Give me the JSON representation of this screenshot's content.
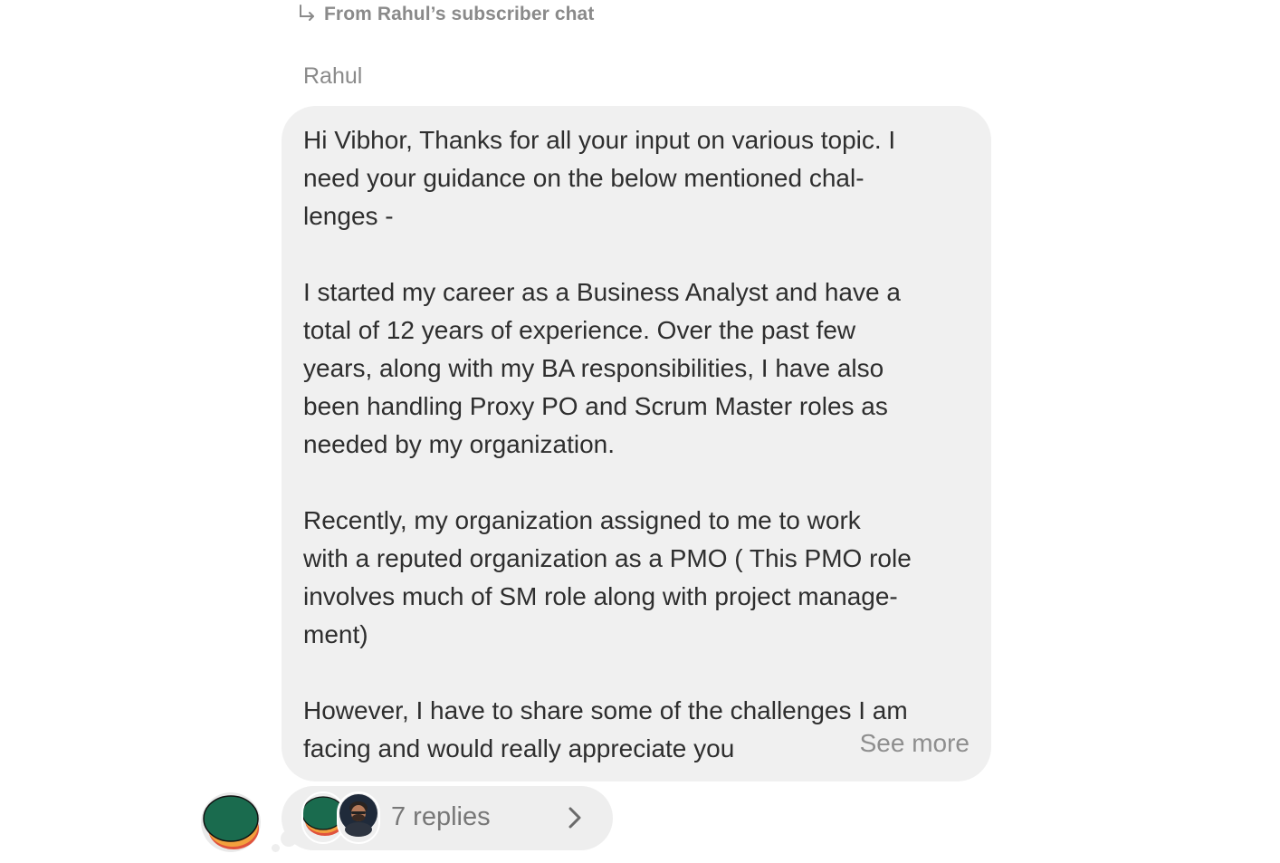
{
  "header": {
    "forwarded_from": "From Rahul’s subscriber chat"
  },
  "message": {
    "sender": "Rahul",
    "paragraphs": [
      [
        "Hi Vibhor, Thanks for all your input on various topic. I",
        "need your guidance on the below mentioned chal-",
        "lenges -"
      ],
      [
        "I started my career as a Business Analyst and have a",
        "total of 12 years of experience. Over the past few",
        "years, along with my BA responsibilities, I have also",
        "been handling Proxy PO and Scrum Master roles as",
        "needed by my organization."
      ],
      [
        "Recently, my organization assigned to me to work",
        "with a reputed organization as a PMO ( This PMO role",
        "involves much of SM role along with project manage-",
        "ment)"
      ],
      [
        "However, I have to share some of the challenges I am",
        "facing and would really appreciate you"
      ]
    ],
    "see_more": "See more"
  },
  "thread": {
    "replies_label": "7 replies",
    "icons": [
      "forward-arrow-icon",
      "chevron-right-icon"
    ]
  },
  "colors": {
    "bubble": "#f0f0f0",
    "muted_text": "#8a8a8a",
    "avatar_green": "#1a6b4e",
    "avatar_orange": "#f2a03d",
    "avatar_red": "#e0523c"
  }
}
